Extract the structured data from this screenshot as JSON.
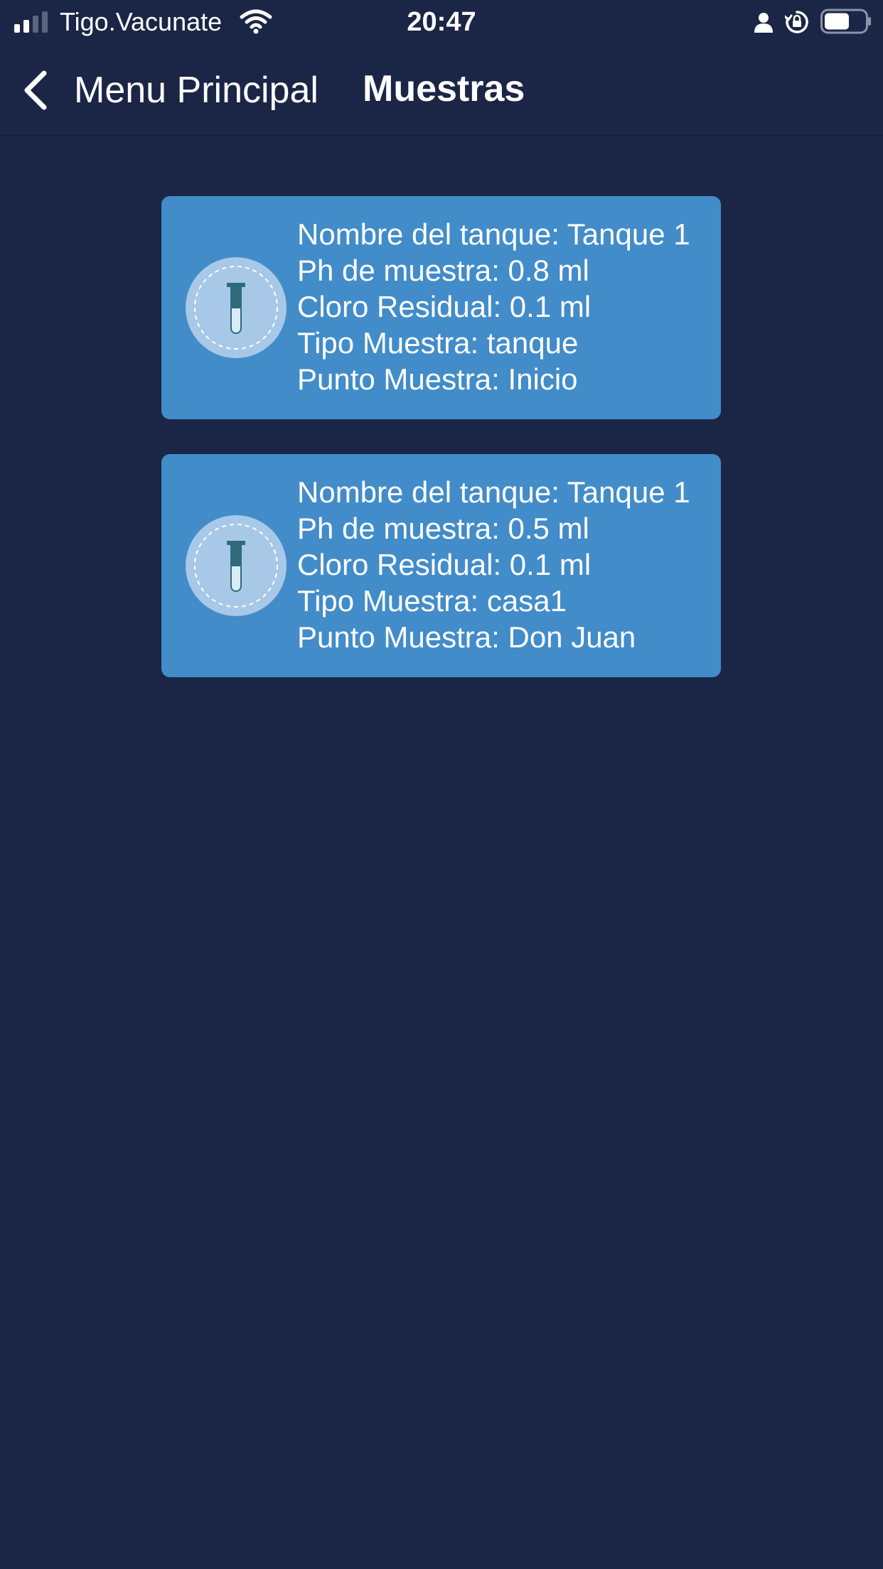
{
  "status_bar": {
    "carrier": "Tigo.Vacunate",
    "time": "20:47",
    "signal_bars_active": 2,
    "signal_bars_total": 4,
    "battery_level": 0.6
  },
  "nav": {
    "back_label": "Menu Principal",
    "title": "Muestras"
  },
  "samples": [
    {
      "icon": "test-tube-icon",
      "tank_name": "Nombre del tanque: Tanque 1",
      "ph": "Ph de muestra: 0.8 ml",
      "residual_chlorine": "Cloro Residual: 0.1 ml",
      "sample_type": "Tipo Muestra: tanque",
      "sample_point": "Punto Muestra: Inicio"
    },
    {
      "icon": "test-tube-icon",
      "tank_name": "Nombre del tanque: Tanque 1",
      "ph": "Ph de muestra: 0.5 ml",
      "residual_chlorine": "Cloro Residual: 0.1 ml",
      "sample_type": "Tipo Muestra: casa1",
      "sample_point": "Punto Muestra: Don Juan"
    }
  ],
  "colors": {
    "background": "#1b2646",
    "card": "#428cc9",
    "icon_circle": "#a8c8e8",
    "tube_dark": "#2f6b7a",
    "text": "#ffffff"
  }
}
